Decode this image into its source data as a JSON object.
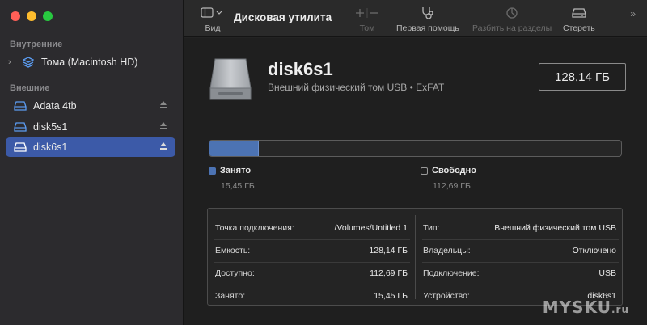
{
  "app": {
    "title": "Дисковая утилита"
  },
  "toolbar": {
    "view_label": "Вид",
    "volume_label": "Том",
    "first_aid_label": "Первая помощь",
    "partition_label": "Разбить на разделы",
    "erase_label": "Стереть"
  },
  "sidebar": {
    "internal_label": "Внутренние",
    "external_label": "Внешние",
    "internal_items": [
      {
        "label": "Тома (Macintosh HD)"
      }
    ],
    "external_items": [
      {
        "label": "Adata 4tb"
      },
      {
        "label": "disk5s1"
      },
      {
        "label": "disk6s1",
        "selected": true
      }
    ]
  },
  "disk": {
    "name": "disk6s1",
    "subtitle": "Внешний физический том USB • ExFAT",
    "size": "128,14 ГБ",
    "used_fraction": 0.1206
  },
  "legend": {
    "used_label": "Занято",
    "used_value": "15,45 ГБ",
    "free_label": "Свободно",
    "free_value": "112,69 ГБ"
  },
  "info": {
    "left": [
      {
        "key": "Точка подключения:",
        "value": "/Volumes/Untitled 1"
      },
      {
        "key": "Емкость:",
        "value": "128,14 ГБ"
      },
      {
        "key": "Доступно:",
        "value": "112,69 ГБ"
      },
      {
        "key": "Занято:",
        "value": "15,45 ГБ"
      }
    ],
    "right": [
      {
        "key": "Тип:",
        "value": "Внешний физический том USB"
      },
      {
        "key": "Владельцы:",
        "value": "Отключено"
      },
      {
        "key": "Подключение:",
        "value": "USB"
      },
      {
        "key": "Устройство:",
        "value": "disk6s1"
      }
    ]
  },
  "colors": {
    "accent": "#3c5aa8",
    "used": "#4c73b3",
    "sidebar_icon": "#5b9cf2"
  },
  "watermark": {
    "text": "MYSKU",
    "suffix": ".ru"
  }
}
